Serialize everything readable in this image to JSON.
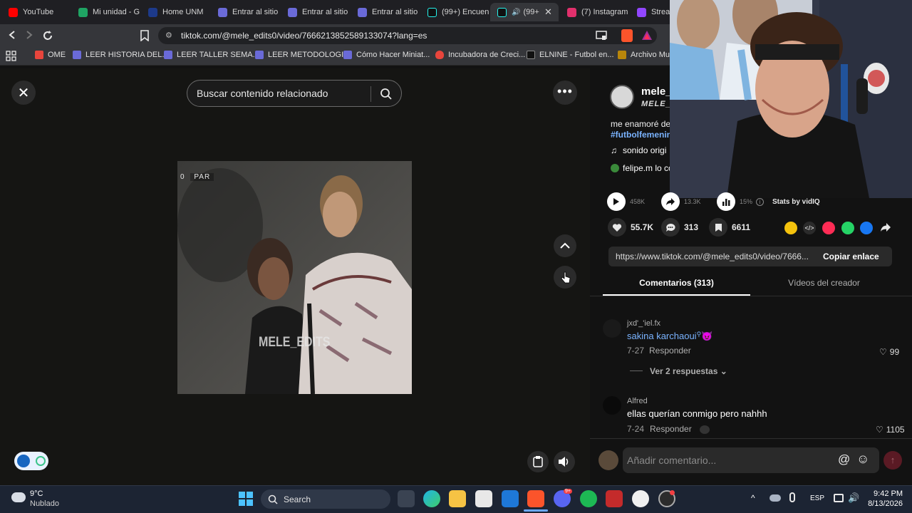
{
  "tabs": [
    {
      "label": "YouTube",
      "color": "#ff0000"
    },
    {
      "label": "Mi unidad - G",
      "color": "#1fa463"
    },
    {
      "label": "Home UNM",
      "color": "#1d3a8a"
    },
    {
      "label": "Entrar al sitio",
      "color": "#6a6ad8"
    },
    {
      "label": "Entrar al sitio",
      "color": "#6a6ad8"
    },
    {
      "label": "Entrar al sitio",
      "color": "#6a6ad8"
    },
    {
      "label": "(99+) Encuen",
      "color": "#111111"
    },
    {
      "label": "(99+",
      "color": "#111111"
    },
    {
      "label": "(7) Instagram",
      "color": "#e1306c"
    },
    {
      "label": "Stream",
      "color": "#9146ff"
    }
  ],
  "address_bar": {
    "url": "tiktok.com/@mele_edits0/video/7666213852589133074?lang=es"
  },
  "bookmarks": [
    {
      "label": "OME",
      "color": "#e8453c"
    },
    {
      "label": "LEER HISTORIA DEL...",
      "color": "#6a6ad8"
    },
    {
      "label": "LEER TALLER SEMA...",
      "color": "#6a6ad8"
    },
    {
      "label": "LEER METODOLOGIA",
      "color": "#6a6ad8"
    },
    {
      "label": "Cómo Hacer Miniat...",
      "color": "#6a6ad8"
    },
    {
      "label": "Incubadora de Creci...",
      "color": "#e8453c"
    },
    {
      "label": "ELNINE - Futbol en...",
      "color": "#111111"
    },
    {
      "label": "Archivo Mun",
      "color": "#333333"
    }
  ],
  "search": {
    "placeholder": "Buscar contenido relacionado"
  },
  "video": {
    "watermark": "MELE_EDITS",
    "overlay_num": "0",
    "overlay_text": "PAR"
  },
  "creator": {
    "username": "mele_",
    "handle": "MELE_E",
    "description": "me enamoré de",
    "hashtag": "#futbolfemenin",
    "sound": "sonido origi",
    "mention": "felipe.m lo co"
  },
  "vidiq": {
    "views": "458K",
    "shares": "13.3K",
    "engagement": "15%",
    "label": "Stats by vidIQ"
  },
  "actions": {
    "likes": "55.7K",
    "comments": "313",
    "saves": "6611"
  },
  "link": {
    "url": "https://www.tiktok.com/@mele_edits0/video/7666...",
    "copy_label": "Copiar enlace"
  },
  "panel_tabs": {
    "comments": "Comentarios (313)",
    "creator_videos": "Vídeos del creador"
  },
  "comments": [
    {
      "user": "jxd'_'iel.fx",
      "text": "sakina karchaoui",
      "date": "7-27",
      "reply": "Responder",
      "likes": "99",
      "view_replies": "Ver 2 respuestas"
    },
    {
      "user": "Alfred",
      "text": "ellas querían conmigo pero nahhh",
      "date": "7-24",
      "reply": "Responder",
      "likes": "1105"
    }
  ],
  "comment_box": {
    "placeholder": "Añadir comentario..."
  },
  "taskbar": {
    "temp": "9°C",
    "weather": "Nublado",
    "search": "Search",
    "lang": "ESP",
    "time": "9:42 PM",
    "date": "8/13/2026",
    "discord_badge": "9+"
  }
}
